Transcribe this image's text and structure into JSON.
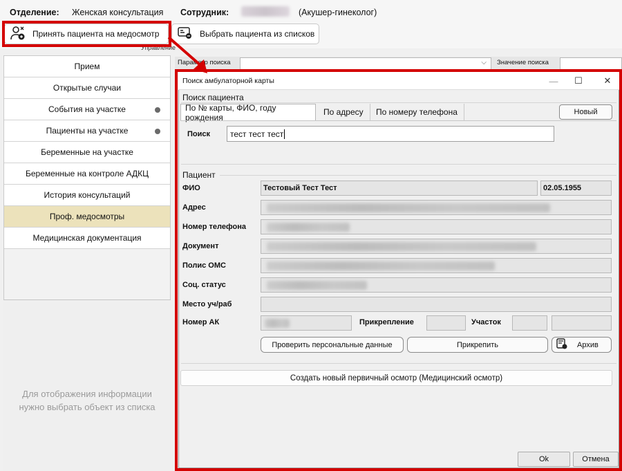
{
  "header": {
    "dept_label": "Отделение:",
    "dept_value": "Женская консультация",
    "employee_label": "Сотрудник:",
    "employee_role": "(Акушер-гинеколог)"
  },
  "toolbar": {
    "accept_label": "Принять пациента на медосмотр",
    "choose_label": "Выбрать пациента из списков",
    "group_label": "Управление"
  },
  "sidebar": {
    "items": [
      {
        "label": "Прием"
      },
      {
        "label": "Открытые случаи"
      },
      {
        "label": "События на участке"
      },
      {
        "label": "Пациенты на участке"
      },
      {
        "label": "Беременные на участке"
      },
      {
        "label": "Беременные на контроле АДКЦ"
      },
      {
        "label": "История консультаций"
      },
      {
        "label": "Проф. медосмотры"
      },
      {
        "label": "Медицинская документация"
      }
    ],
    "empty_hint_line1": "Для отображения информации",
    "empty_hint_line2": "нужно выбрать объект из списка"
  },
  "search_bar": {
    "param_label": "Параметр поиска",
    "value_label": "Значение поиска"
  },
  "dialog": {
    "title": "Поиск амбулаторной карты",
    "search_section": "Поиск пациента",
    "tabs": [
      {
        "label": "По № карты, ФИО, году рождения"
      },
      {
        "label": "По адресу"
      },
      {
        "label": "По номеру телефона"
      }
    ],
    "new_button": "Новый",
    "search_label": "Поиск",
    "search_value": "тест тест тест",
    "patient_section": "Пациент",
    "fio_label": "ФИО",
    "fio_value": "Тестовый Тест Тест",
    "birth_date": "02.05.1955",
    "address_label": "Адрес",
    "phone_label": "Номер телефона",
    "document_label": "Документ",
    "oms_label": "Полис ОМС",
    "social_label": "Соц. статус",
    "work_label": "Место уч/раб",
    "ak_label": "Номер АК",
    "attach_label": "Прикрепление",
    "district_label": "Участок",
    "check_button": "Проверить персональные данные",
    "attach_button": "Прикрепить",
    "archive_button": "Архив",
    "create_button": "Создать новый первичный осмотр (Медицинский осмотр)",
    "ok_button": "Ok",
    "cancel_button": "Отмена"
  },
  "colors": {
    "highlight": "#d40000",
    "selected_nav": "#ece2bb"
  }
}
